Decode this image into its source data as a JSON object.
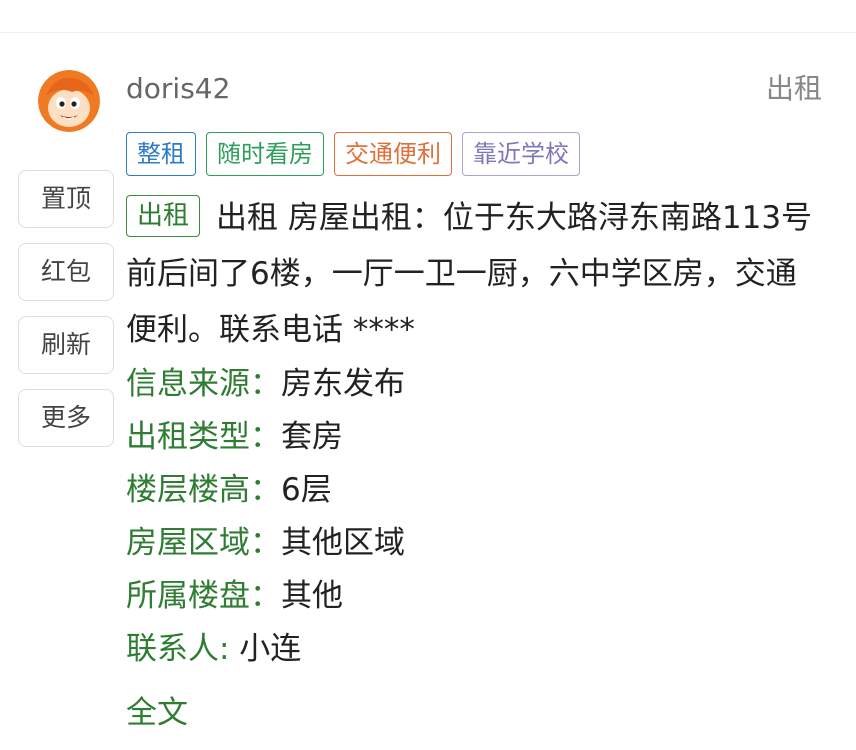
{
  "post": {
    "username": "doris42",
    "type_label": "出租",
    "tags": [
      {
        "label": "整租",
        "color": "#2f7cc2"
      },
      {
        "label": "随时看房",
        "color": "#2e9f5b"
      },
      {
        "label": "交通便利",
        "color": "#e0703a"
      },
      {
        "label": "靠近学校",
        "color": "#7e78b8"
      }
    ],
    "badge": "出租",
    "description": "出租 房屋出租：位于东大路浔东南路113号前后间了6楼，一厅一卫一厨，六中学区房，交通便利。联系电话 ****",
    "info": [
      {
        "label": "信息来源：",
        "value": "房东发布"
      },
      {
        "label": "出租类型：",
        "value": "套房"
      },
      {
        "label": "楼层楼高：",
        "value": "6层"
      },
      {
        "label": "房屋区域：",
        "value": "其他区域"
      },
      {
        "label": "所属楼盘：",
        "value": "其他"
      },
      {
        "label": "联系人:",
        "value": " 小连"
      }
    ],
    "full_text_link": "全文"
  },
  "side_actions": [
    "置顶",
    "红包",
    "刷新",
    "更多"
  ],
  "icons": {
    "avatar": "cartoon-avatar-icon"
  }
}
